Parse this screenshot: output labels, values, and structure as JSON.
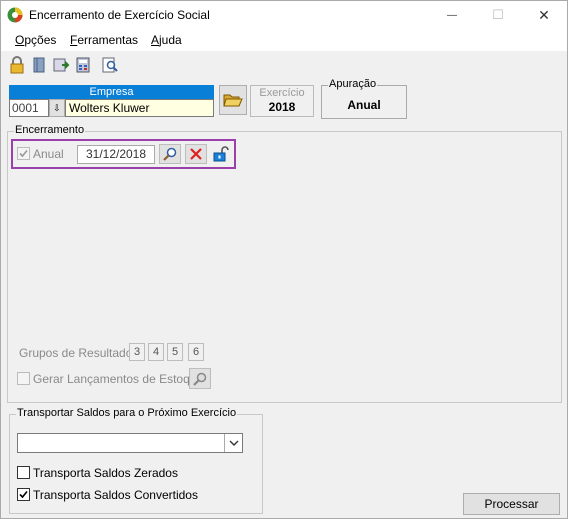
{
  "window": {
    "title": "Encerramento de Exercício Social",
    "minimize_glyph": "—",
    "maximize_glyph": "☐",
    "close_glyph": "✕"
  },
  "menu": {
    "items": [
      {
        "first": "O",
        "rest": "pções"
      },
      {
        "first": "F",
        "rest": "erramentas"
      },
      {
        "first": "A",
        "rest": "juda"
      }
    ]
  },
  "toolbar": {
    "icons": [
      "lock-icon",
      "book-icon",
      "export-icon",
      "calculator-icon",
      "preview-icon"
    ]
  },
  "empresa": {
    "header": "Empresa",
    "code": "0001",
    "dropdown_glyph": "⇩",
    "name": "Wolters Kluwer"
  },
  "exercicio": {
    "label": "Exercício",
    "value": "2018"
  },
  "apuracao": {
    "label": "Apuração",
    "value": "Anual"
  },
  "encerramento": {
    "legend": "Encerramento",
    "anual_label": "Anual",
    "anual_checked": true,
    "date": "31/12/2018",
    "grupos_label": "Grupos de Resultado:",
    "grupos": [
      "3",
      "4",
      "5",
      "6"
    ],
    "gerar_label": "Gerar Lançamentos de Estoque",
    "gerar_checked": false
  },
  "transportar": {
    "legend": "Transportar Saldos para o Próximo Exercício",
    "combo_value": "",
    "zerados_label": "Transporta Saldos Zerados",
    "zerados_checked": false,
    "convertidos_label": "Transporta Saldos Convertidos",
    "convertidos_checked": true
  },
  "processar_label": "Processar",
  "colors": {
    "accent_blue": "#0a7fd8",
    "highlight_purple": "#9b3faa",
    "field_yellow": "#ffffe1"
  }
}
